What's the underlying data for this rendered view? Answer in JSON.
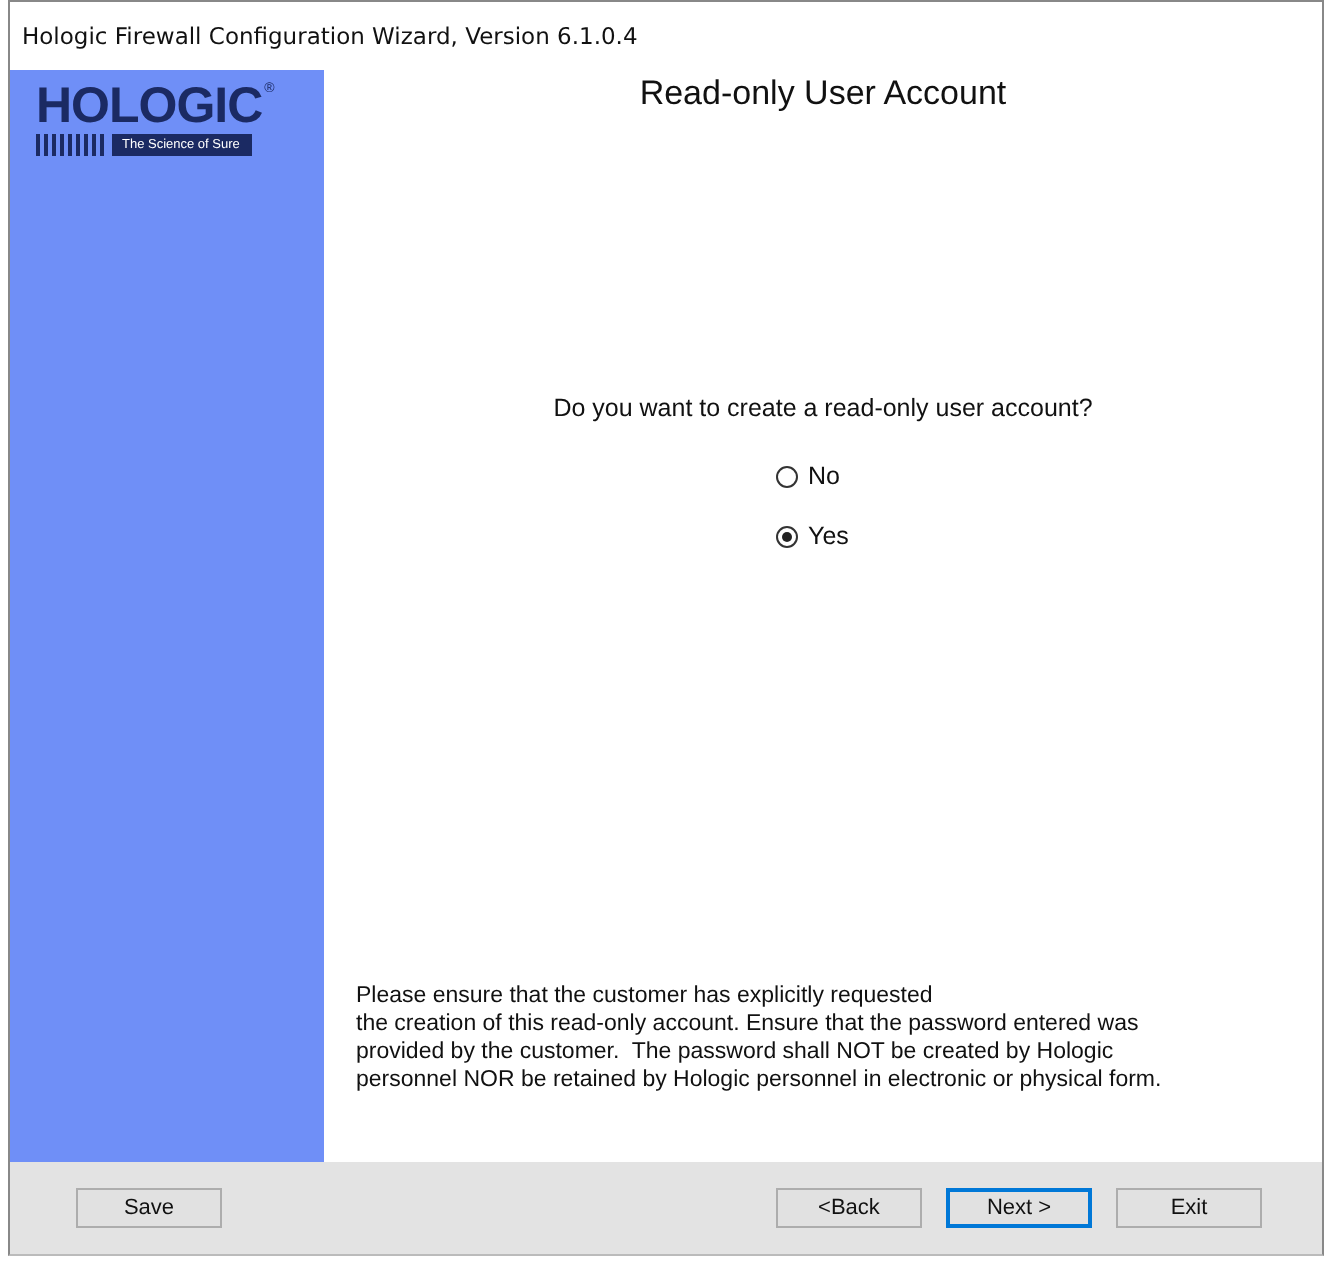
{
  "window": {
    "title": "Hologic Firewall Configuration Wizard, Version 6.1.0.4"
  },
  "logo": {
    "name": "HOLOGIC",
    "mark": "®",
    "tagline": "The Science of Sure"
  },
  "page": {
    "heading": "Read-only User Account",
    "question": "Do you want to create a read-only user account?",
    "options": [
      {
        "label": "No",
        "selected": false
      },
      {
        "label": "Yes",
        "selected": true
      }
    ],
    "notice": "Please ensure that the customer has explicitly requested\nthe creation of this read-only account. Ensure that the password entered was\nprovided by the customer.  The password shall NOT be created by Hologic\npersonnel NOR be retained by Hologic personnel in electronic or physical form."
  },
  "buttons_left": [
    {
      "label": "Save",
      "default": false
    }
  ],
  "buttons_right": [
    {
      "label": "<Back",
      "default": false
    },
    {
      "label": "Next >",
      "default": true
    },
    {
      "label": "Exit",
      "default": false
    }
  ]
}
